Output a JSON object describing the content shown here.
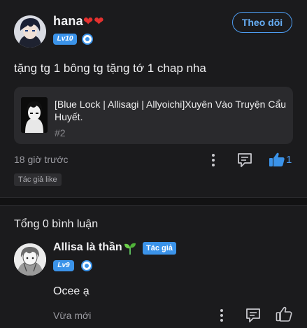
{
  "post": {
    "author": {
      "name": "hana",
      "name_suffix": "❤️❤️",
      "level": "Lv10"
    },
    "follow_button": "Theo dõi",
    "text": "tặng tg 1 bông tg tặng tớ 1 chap nha",
    "chapter_card": {
      "title": "[Blue Lock | Allisagi | Allyoichi]Xuyên Vào Truyện Cẩu Huyết.",
      "number": "#2"
    },
    "timestamp": "18 giờ trước",
    "like_count": "1",
    "author_like_tag": "Tác giả like"
  },
  "replies": {
    "total_label": "Tổng 0 bình luận",
    "items": [
      {
        "name": "Allisa là thần",
        "author_badge": "Tác giả",
        "level": "Lv9",
        "text": "Ocee ạ",
        "timestamp": "Vừa mới"
      }
    ]
  },
  "colors": {
    "background": "#1b1b1d",
    "accent_blue": "#3b93e9",
    "card": "#2a2a2d",
    "muted_text": "#9a9aa0"
  },
  "icons": {
    "more": "more-vertical-icon",
    "comment": "comment-icon",
    "like": "thumbs-up-icon",
    "verified": "shield-icon",
    "sprout": "sprout-icon"
  }
}
